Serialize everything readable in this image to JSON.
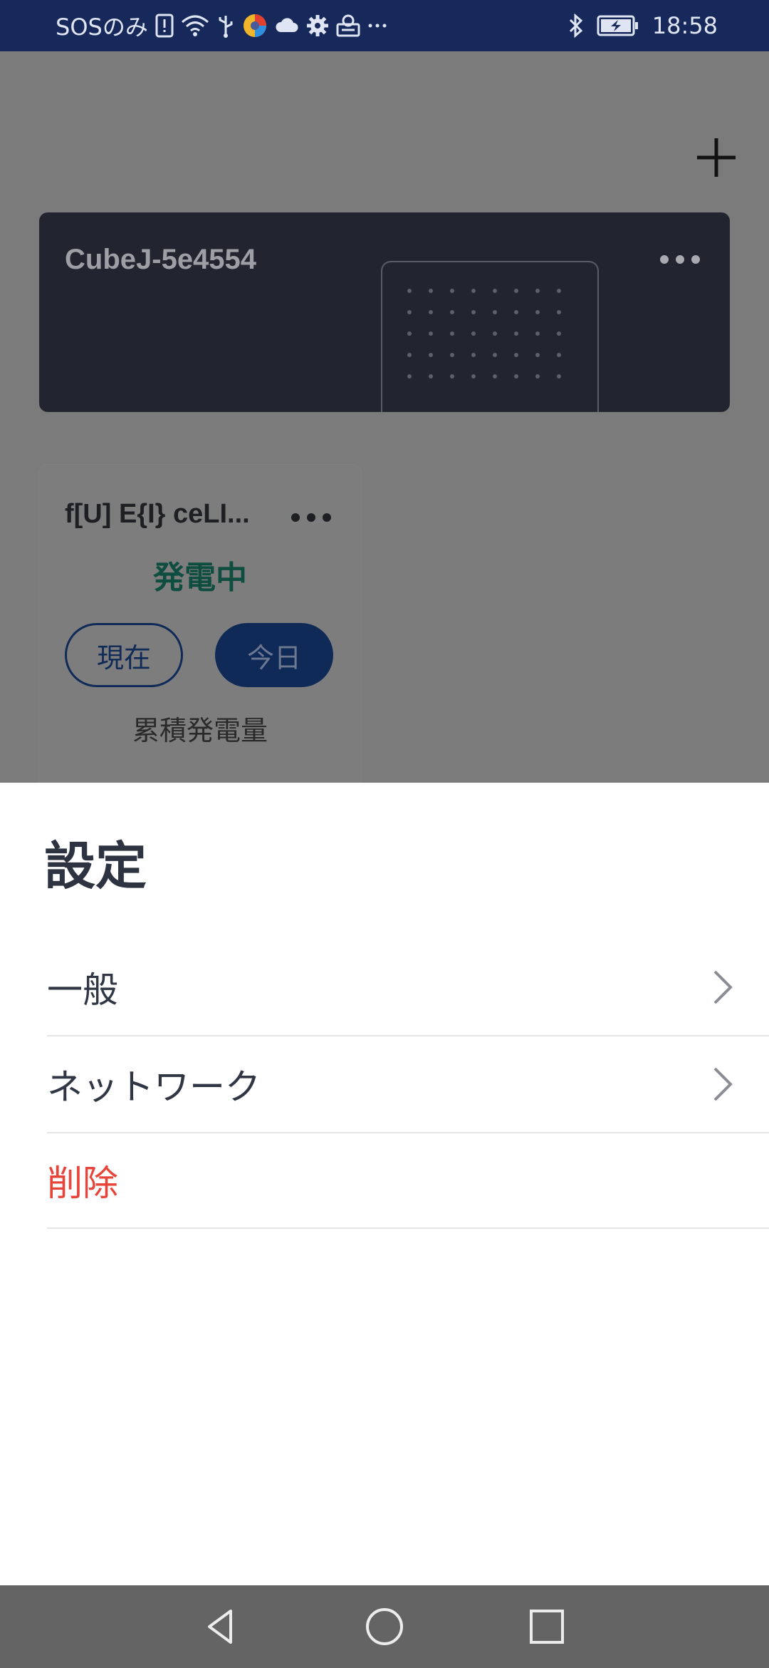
{
  "status_bar": {
    "carrier": "SOSのみ",
    "time": "18:58",
    "icons": [
      "sim-alert-icon",
      "wifi-icon",
      "usb-icon",
      "app-color-icon",
      "cloud-icon",
      "gear-icon",
      "app-icon",
      "more-icon",
      "bluetooth-icon",
      "battery-charging-icon"
    ]
  },
  "background": {
    "add_icon": "plus-icon",
    "device_card": {
      "name": "CubeJ-5e4554",
      "more_icon": "more-horizontal-icon"
    },
    "sensor_card": {
      "name": "f[U] E{I} ceLI...",
      "status": "発電中",
      "buttons": [
        "現在",
        "今日"
      ],
      "selected": "今日",
      "label": "累積発電量",
      "status_color": "#0e4d3f"
    }
  },
  "sheet": {
    "title": "設定",
    "items": [
      {
        "label": "一般",
        "has_chevron": true
      },
      {
        "label": "ネットワーク",
        "has_chevron": true
      },
      {
        "label": "削除",
        "has_chevron": false,
        "color": "#e8453a"
      }
    ]
  },
  "nav_bar": {
    "buttons": [
      "back-icon",
      "home-icon",
      "recents-icon"
    ]
  }
}
